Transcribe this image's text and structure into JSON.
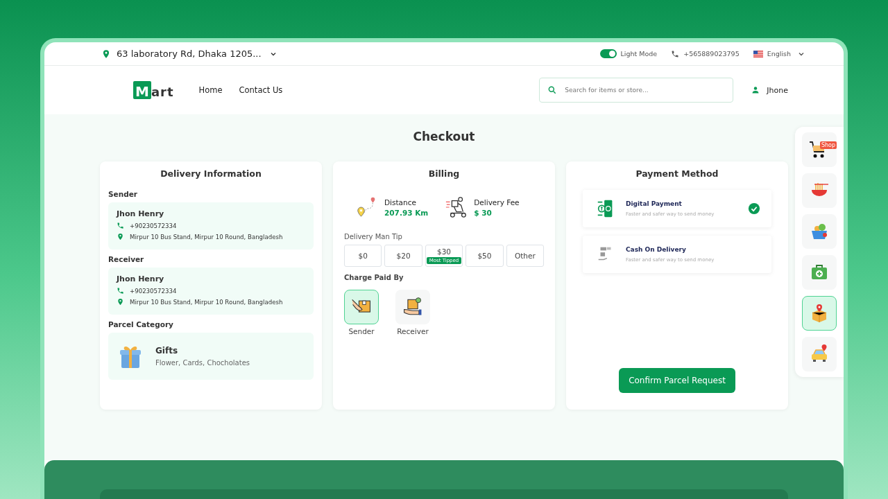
{
  "top_bar": {
    "address": "63 laboratory Rd, Dhaka 1205...",
    "theme_toggle": {
      "label": "Light Mode",
      "on": true
    },
    "phone": "+565889023795",
    "language": "English"
  },
  "nav": {
    "logo": {
      "letter": "M",
      "rest": "art"
    },
    "links": [
      "Home",
      "Contact Us"
    ],
    "search": {
      "placeholder": "Search for items or store..."
    },
    "user": "Jhone"
  },
  "page_title": "Checkout",
  "delivery_info": {
    "title": "Delivery Information",
    "contacts": [
      {
        "label": "Sender",
        "name": "Jhon Henry",
        "phone": "+90230572334",
        "address": "Mirpur 10 Bus Stand, Mirpur 10 Round, Bangladesh"
      },
      {
        "label": "Receiver",
        "name": "Jhon Henry",
        "phone": "+90230572334",
        "address": "Mirpur 10 Bus Stand, Mirpur 10 Round, Bangladesh"
      }
    ],
    "parcel_category": {
      "label": "Parcel Category",
      "name": "Gifts",
      "description": "Flower, Cards, Chocholates"
    }
  },
  "billing": {
    "title": "Billing",
    "stats": [
      {
        "kind": "distance",
        "label": "Distance",
        "value": "207.93 Km"
      },
      {
        "kind": "fee",
        "label": "Delivery Fee",
        "value": "$ 30"
      }
    ],
    "tip_label": "Delivery Man Tip",
    "tips": [
      {
        "label": "$0",
        "selected": false
      },
      {
        "label": "$20",
        "selected": false
      },
      {
        "label": "$30",
        "badge": "Most Tipped",
        "selected": false
      },
      {
        "label": "$50",
        "selected": false
      },
      {
        "label": "Other",
        "selected": false
      }
    ],
    "charge_label": "Charge Paid By",
    "payers": [
      {
        "kind": "sender",
        "label": "Sender",
        "selected": true
      },
      {
        "kind": "receiver",
        "label": "Receiver",
        "selected": false
      }
    ]
  },
  "payment": {
    "title": "Payment Method",
    "methods": [
      {
        "kind": "digital",
        "name": "Digital Payment",
        "description": "Faster and safer way to send money",
        "selected": true
      },
      {
        "kind": "cash",
        "name": "Cash On Delivery",
        "description": "Faster and safer way to send money",
        "selected": false
      }
    ],
    "confirm_button": "Confirm Parcel Request"
  },
  "side_rail": [
    {
      "kind": "shop",
      "badge": "Shop",
      "selected": false
    },
    {
      "kind": "food",
      "selected": false
    },
    {
      "kind": "grocery",
      "selected": false
    },
    {
      "kind": "pharmacy",
      "selected": false
    },
    {
      "kind": "parcel",
      "selected": true
    },
    {
      "kind": "ride",
      "selected": false
    }
  ]
}
